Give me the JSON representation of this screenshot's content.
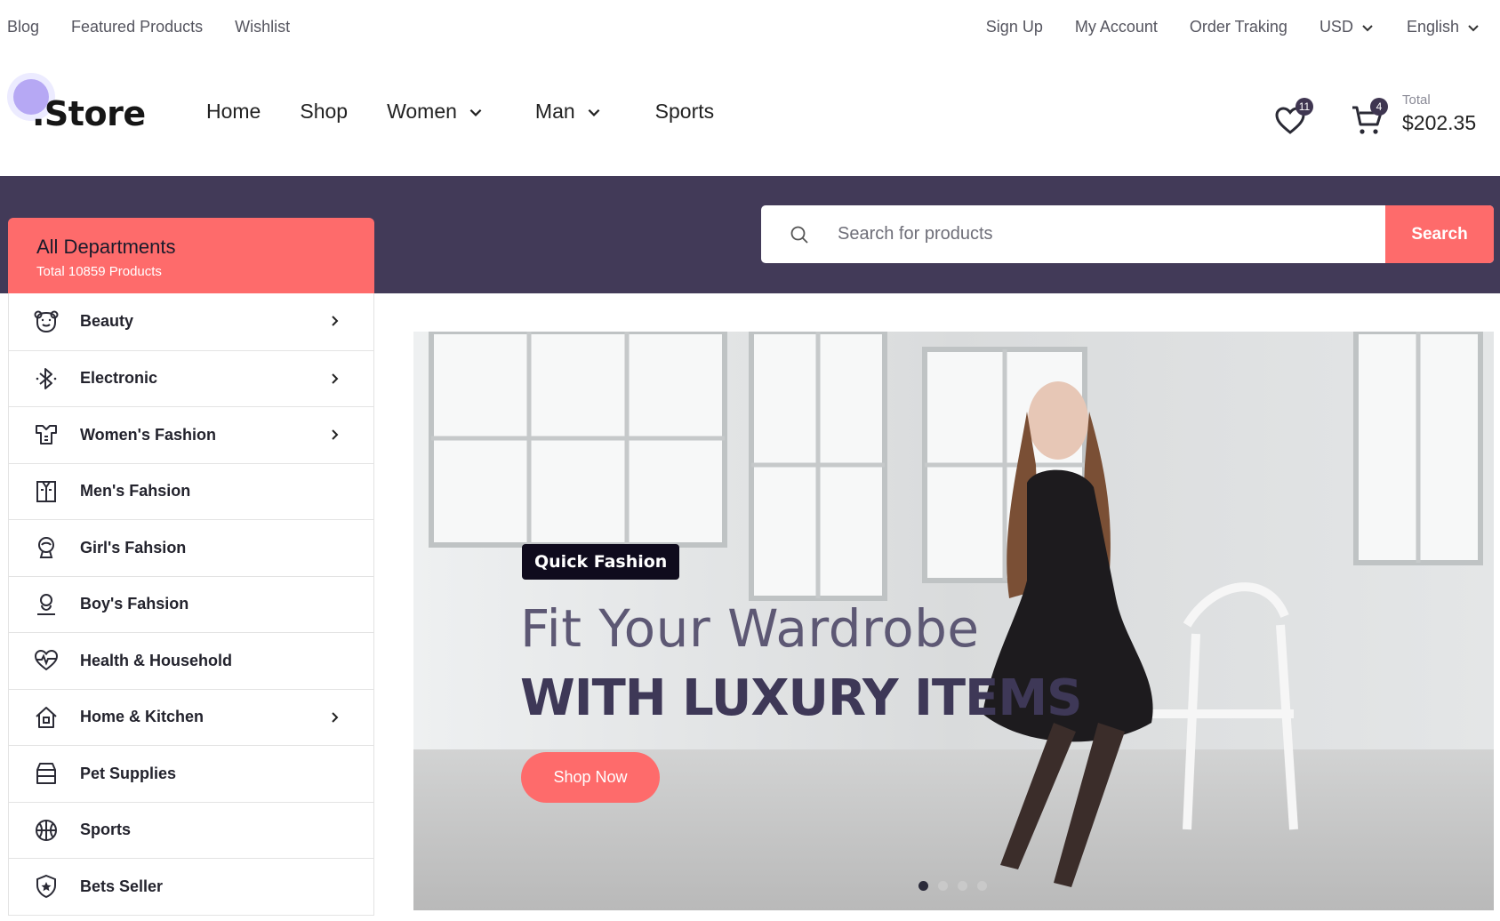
{
  "topbar": {
    "left_links": [
      "Blog",
      "Featured Products",
      "Wishlist"
    ],
    "right_links": [
      "Sign Up",
      "My Account",
      "Order Traking"
    ],
    "currency": "USD",
    "language": "English"
  },
  "header": {
    "logo_text": ".Store",
    "nav": [
      "Home",
      "Shop",
      "Women",
      "Man",
      "Sports"
    ],
    "wishlist_count": "11",
    "cart_count": "4",
    "total_label": "Total",
    "total_value": "$202.35"
  },
  "search": {
    "placeholder": "Search for products",
    "button_label": "Search"
  },
  "departments": {
    "title": "All Departments",
    "subtitle": "Total 10859 Products",
    "items": [
      {
        "label": "Beauty",
        "icon": "bear-face-icon",
        "has_submenu": true
      },
      {
        "label": "Electronic",
        "icon": "bluetooth-icon",
        "has_submenu": true
      },
      {
        "label": "Women's Fashion",
        "icon": "dress-icon",
        "has_submenu": true
      },
      {
        "label": "Men's Fahsion",
        "icon": "shirt-icon",
        "has_submenu": false
      },
      {
        "label": "Girl's Fahsion",
        "icon": "girl-icon",
        "has_submenu": false
      },
      {
        "label": "Boy's Fahsion",
        "icon": "boy-icon",
        "has_submenu": false
      },
      {
        "label": "Health & Household",
        "icon": "heartbeat-icon",
        "has_submenu": false
      },
      {
        "label": "Home & Kitchen",
        "icon": "house-icon",
        "has_submenu": true
      },
      {
        "label": "Pet Supplies",
        "icon": "pet-bag-icon",
        "has_submenu": false
      },
      {
        "label": "Sports",
        "icon": "basketball-icon",
        "has_submenu": false
      },
      {
        "label": "Bets Seller",
        "icon": "star-shield-icon",
        "has_submenu": false
      }
    ]
  },
  "hero": {
    "tag": "Quick Fashion",
    "line1": "Fit Your Wardrobe",
    "line2": "WITH LUXURY ITEMS",
    "button_label": "Shop Now",
    "slide_count": 4,
    "active_slide": 1
  },
  "colors": {
    "accent": "#fe6b6b",
    "band": "#423a58",
    "heading": "#3e3857"
  }
}
